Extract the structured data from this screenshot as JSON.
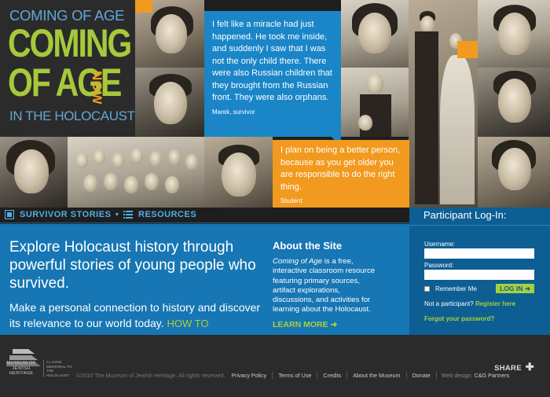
{
  "logo": {
    "line_small": "COMING OF AGE",
    "line_big1": "COMING",
    "line_big2": "OF AGE",
    "line_now": "NOW",
    "line_holocaust": "IN THE HOLOCAUST"
  },
  "quotes": [
    {
      "text": "I felt like a miracle had just happened. He took me inside, and suddenly I saw that I was not the only child there. There were also Russian children that they brought from the Russian front. They were also orphans.",
      "attribution": "Marek, survivor"
    },
    {
      "text": "I plan on being a better person, because as you get older you are responsible to do the right thing.",
      "attribution": "Student"
    }
  ],
  "nav": {
    "survivor_stories": "SURVIVOR STORIES",
    "resources": "RESOURCES"
  },
  "main": {
    "headline": "Explore Holocaust history through powerful stories of young people who survived.",
    "subline": "Make a personal connection to history and discover its relevance to our world today.",
    "how_link": "HOW TO PARTICIPATE",
    "about_title": "About the Site",
    "about_em": "Coming of Age",
    "about_text": " is a free, interactive classroom resource featuring primary sources, artifact explorations, discussions, and activities for learning about the Holocaust.",
    "learn_more": "LEARN MORE"
  },
  "login": {
    "title": "Participant Log-In:",
    "username_label": "Username:",
    "password_label": "Password:",
    "remember_label": "Remember Me",
    "button": "LOG IN",
    "not_participant": "Not a participant?",
    "register": "Register here",
    "forgot": "Forgot your password?"
  },
  "footer": {
    "museum_name": "MUSEUM OF JEWISH HERITAGE",
    "museum_tag": "A LIVING MEMORIAL TO THE HOLOCAUST",
    "copyright": "©2010 The Museum of Jewish Heritage. All rights reserved.",
    "links": [
      "Privacy Policy",
      "Terms of Use",
      "Credits",
      "About the Museum",
      "Donate"
    ],
    "design_label": "Web design:",
    "design_name": "C&G Partners",
    "share": "SHARE"
  },
  "colors": {
    "accent_blue": "#1a86c8",
    "accent_orange": "#f29a1f",
    "accent_green": "#a6d13b",
    "main_blue": "#1776b4",
    "login_blue": "#0d5e93"
  },
  "icons": [
    "survivor-stories-icon",
    "resources-icon",
    "arrow-right-icon",
    "share-plus-icon",
    "museum-logo-icon"
  ]
}
